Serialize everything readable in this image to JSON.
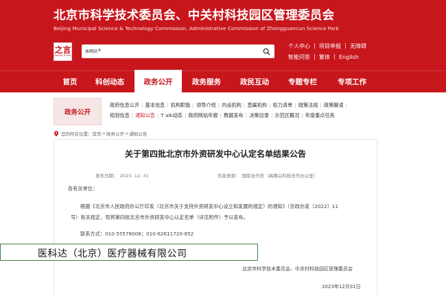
{
  "header": {
    "title_cn": "北京市科学技术委员会、中关村科技园区管理委员会",
    "title_en": "Beijing Municipal Science & Technology Commission, Administrative Commission of Zhongguancun Science Park",
    "logo_mark": "之言",
    "logo_sub": "Beijing-Thinks",
    "search_scope": "本网站",
    "search_value": "",
    "quick_links": [
      [
        "个人中心",
        "项目申报",
        "无障碍"
      ],
      [
        "智能问答",
        "繁体",
        "English"
      ]
    ]
  },
  "nav": [
    "首页",
    "科创动态",
    "政务公开",
    "政务服务",
    "政民互动",
    "专题专栏",
    "专项工作"
  ],
  "subnav": {
    "title": "政务公开",
    "links": [
      "政府信息公开",
      "基本信息",
      "机构职能",
      "领导介绍",
      "内设机构",
      "直属机构",
      "权力清单",
      "政策法规",
      "政策解读",
      "规划信息",
      "通知公告",
      "T alk动态",
      "政府网站年报",
      "数据发布",
      "决策目录",
      "示范区概况",
      "年度重点任务"
    ]
  },
  "breadcrumb": {
    "prefix": "您的所在位置：",
    "items": [
      "首页",
      "政务公开",
      "通知公告"
    ]
  },
  "article": {
    "title": "关于第四批北京市外资研发中心认定名单结果公告",
    "publish_date": "发布日期：　2023- 12- 31",
    "source": "信息来源：　国际合作处（高精尖科技合作办公室）",
    "greeting": "各有关单位：",
    "body_line1": "根据《北京市人民政府办公厅印发〈北京市关于支持外资研发中心设立和发展的规定〉的通知》（京政办发〔2022〕11",
    "body_line2": "号）有关规定，现将第四批北京市外资研发中心认定名单（详见附件）予以发布。",
    "contact": "联系方式：010-55578008；010-62611720-852",
    "signature": "北京市科学技术委员会、中关村科技园区管理委员会",
    "date": "2023年12月31日"
  },
  "overlay": {
    "company": "医科达（北京）医疗器械有限公司"
  },
  "colors": {
    "brand_red": "#c8161d",
    "overlay_border": "#3e7d4a"
  }
}
